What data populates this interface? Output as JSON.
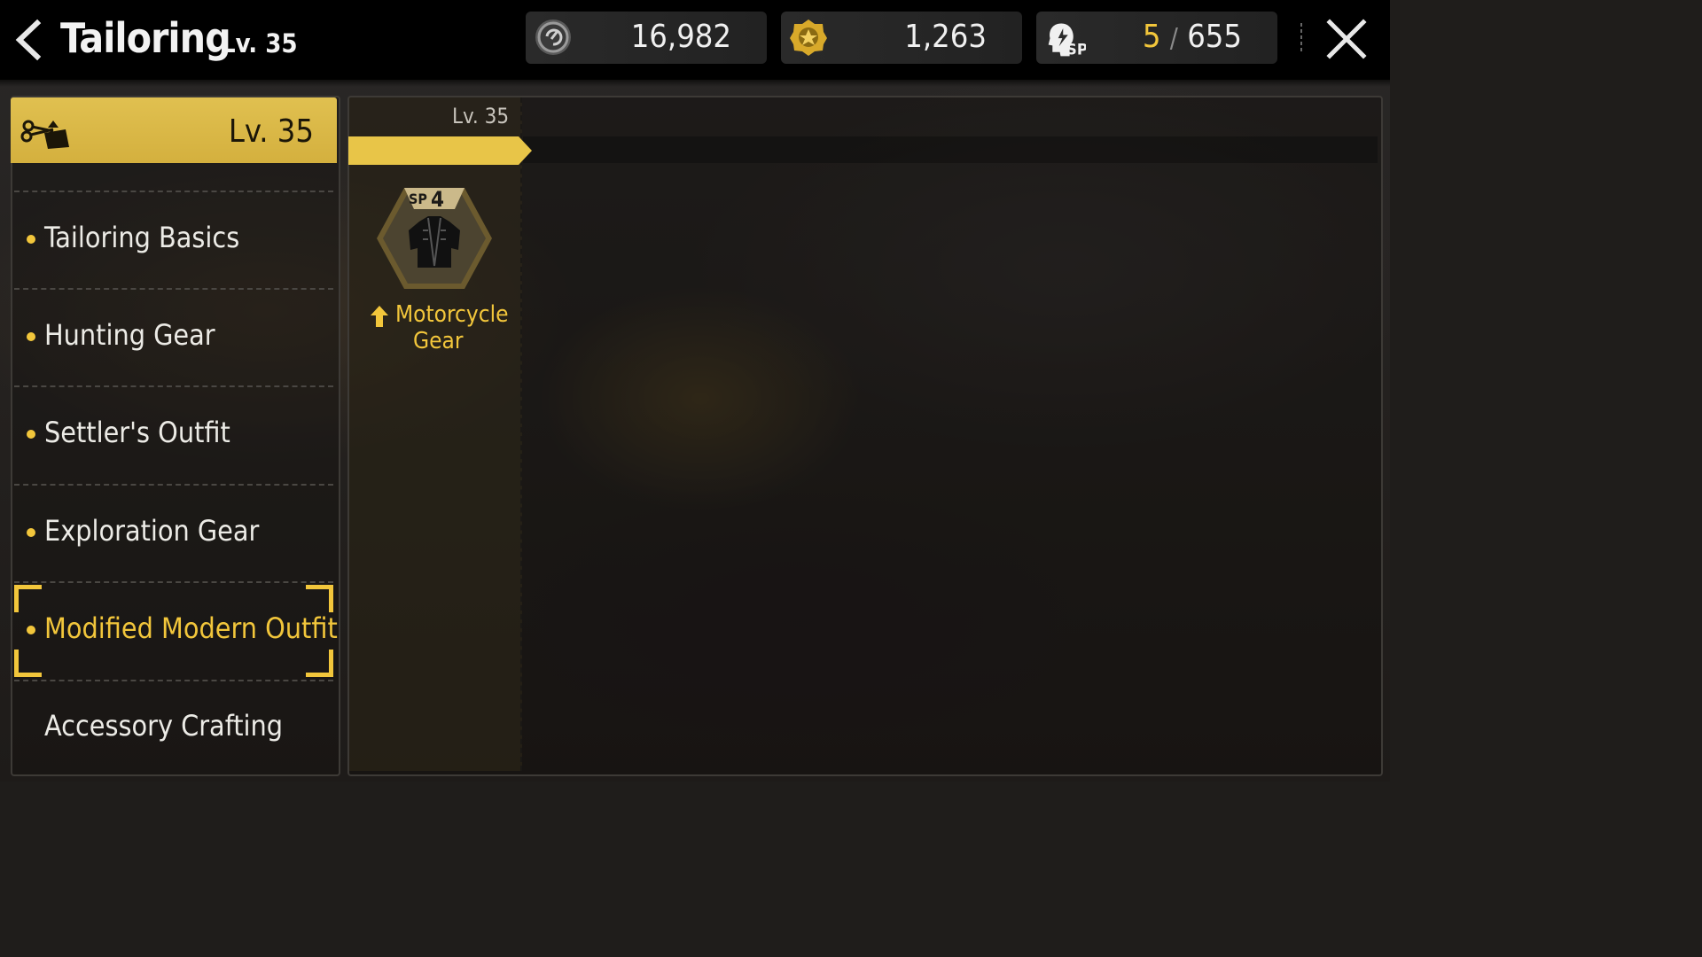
{
  "header": {
    "title": "Tailoring",
    "level": "Lv. 35"
  },
  "resources": {
    "coins": "16,982",
    "gear_tokens": "1,263",
    "sp_current": "5",
    "sp_separator": "/",
    "sp_max": "655"
  },
  "sidebar": {
    "header_level": "Lv. 35",
    "items": [
      {
        "label": "Tailoring Basics",
        "active": false
      },
      {
        "label": "Hunting Gear",
        "active": false
      },
      {
        "label": "Settler's Outfit",
        "active": false
      },
      {
        "label": "Exploration Gear",
        "active": false
      },
      {
        "label": "Modified Modern Outfit",
        "active": true
      },
      {
        "label": "Accessory Crafting",
        "active": false
      }
    ]
  },
  "tree": {
    "column_level": "Lv. 35",
    "node": {
      "sp_label": "SP",
      "sp_cost": "4",
      "name_line1": "Motorcycle",
      "name_line2": "Gear",
      "icon": "jacket-icon",
      "upgrade_icon": "arrow-up-icon"
    }
  },
  "colors": {
    "accent": "#f2c63b",
    "header_gold": "#d4b03e",
    "topbar": "#000000"
  }
}
